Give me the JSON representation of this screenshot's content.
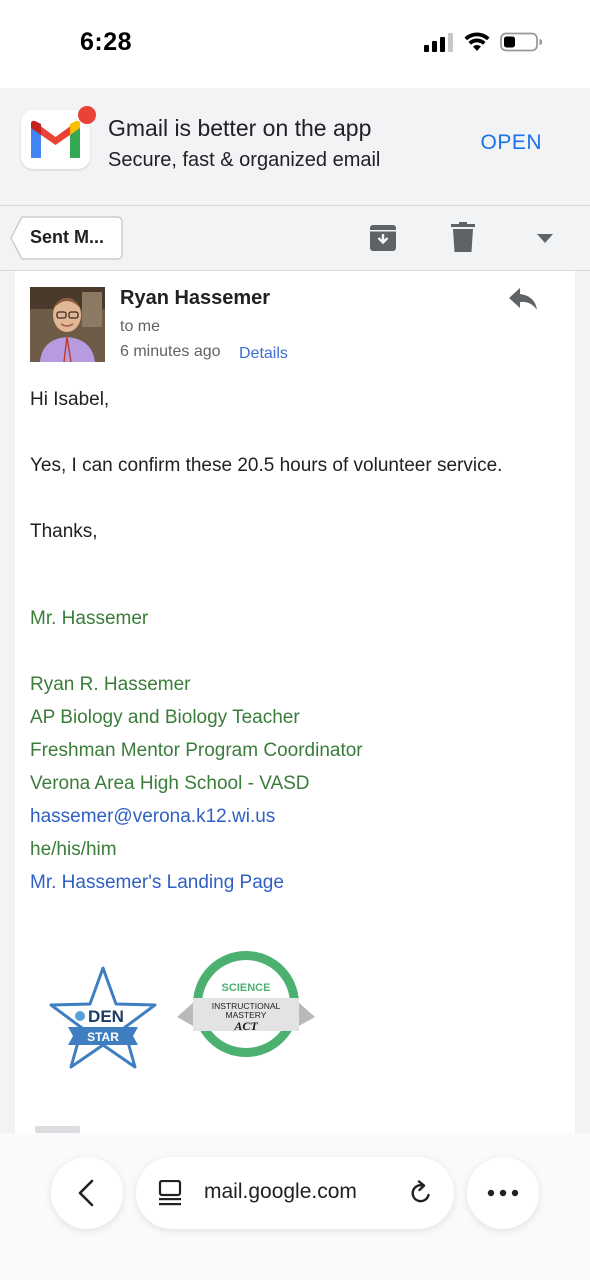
{
  "status_bar": {
    "time": "6:28",
    "icons": [
      "signal-icon",
      "wifi-icon",
      "battery-icon"
    ]
  },
  "app_banner": {
    "title": "Gmail is better on the app",
    "subtitle": "Secure, fast & organized email",
    "open_label": "OPEN",
    "colors": {
      "accent": "#1a73e8",
      "background": "#f1f3f4"
    }
  },
  "toolbar": {
    "back_label": "Sent M...",
    "actions": [
      "archive-icon",
      "delete-icon",
      "more-dropdown-icon"
    ]
  },
  "email": {
    "sender": "Ryan Hassemer",
    "recipient": "to me",
    "time": "6 minutes ago",
    "details_label": "Details",
    "greeting": "Hi Isabel,",
    "body": "Yes, I can confirm these 20.5 hours of volunteer service.",
    "closing": "Thanks,",
    "signature": {
      "short_name": "Mr. Hassemer",
      "full_name": "Ryan R. Hassemer",
      "title1": "AP Biology and Biology Teacher",
      "title2": "Freshman Mentor Program Coordinator",
      "school": "Verona Area High School - VASD",
      "email": "hassemer@verona.k12.wi.us",
      "pronouns": "he/his/him",
      "landing_page": "Mr. Hassemer's Landing Page",
      "colors": {
        "signature_text": "#3a7d3a",
        "link": "#2f5fc4"
      }
    },
    "badges": {
      "den": {
        "line1": "DEN",
        "line2": "STAR"
      },
      "act": {
        "line1": "SCIENCE",
        "line2": "INSTRUCTIONAL",
        "line3": "MASTERY",
        "line4": "ACT"
      }
    }
  },
  "browser": {
    "url": "mail.google.com",
    "icons": [
      "back-icon",
      "page-icon",
      "reload-icon",
      "more-icon"
    ]
  }
}
